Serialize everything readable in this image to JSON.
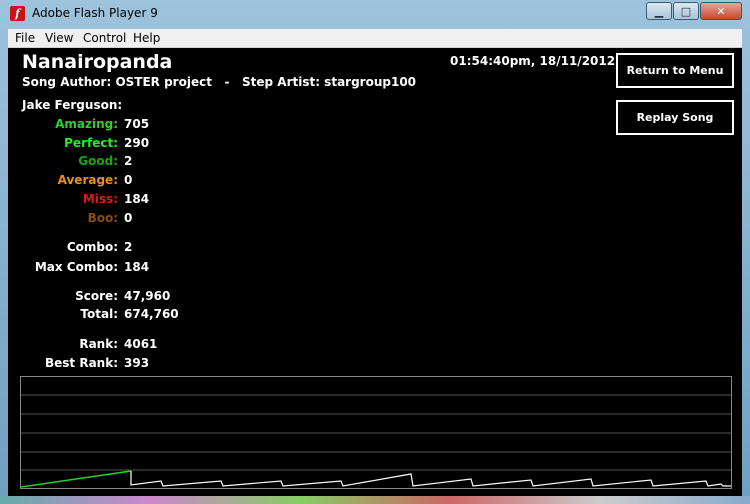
{
  "window": {
    "title": "Adobe Flash Player 9"
  },
  "menu": [
    "File",
    "View",
    "Control",
    "Help"
  ],
  "song": {
    "title": "Nanairopanda",
    "info": "Song Author: OSTER project   -   Step Artist: stargroup100",
    "datetime": "01:54:40pm, 18/11/2012"
  },
  "buttons": {
    "return": "Return to Menu",
    "replay": "Replay Song"
  },
  "player": "Jake Ferguson:",
  "judgements": [
    {
      "label": "Amazing:",
      "value": "705",
      "color": "#33cc33"
    },
    {
      "label": "Perfect:",
      "value": "290",
      "color": "#22ee22"
    },
    {
      "label": "Good:",
      "value": "2",
      "color": "#11aa11"
    },
    {
      "label": "Average:",
      "value": "0",
      "color": "#e8901c"
    },
    {
      "label": "Miss:",
      "value": "184",
      "color": "#e01818"
    },
    {
      "label": "Boo:",
      "value": "0",
      "color": "#8a4a1a"
    }
  ],
  "combo": [
    {
      "label": "Combo:",
      "value": "2",
      "color": "#ffffff"
    },
    {
      "label": "Max Combo:",
      "value": "184",
      "color": "#ffffff"
    }
  ],
  "scores": [
    {
      "label": "Score:",
      "value": "47,960",
      "color": "#ffffff"
    },
    {
      "label": "Total:",
      "value": "674,760",
      "color": "#ffffff"
    }
  ],
  "ranks": [
    {
      "label": "Rank:",
      "value": "4061",
      "color": "#ffffff"
    },
    {
      "label": "Best Rank:",
      "value": "393",
      "color": "#ffffff"
    }
  ],
  "colors": {
    "graph_green": "#22cc22",
    "graph_white": "#ffffff",
    "grid": "#555555"
  }
}
